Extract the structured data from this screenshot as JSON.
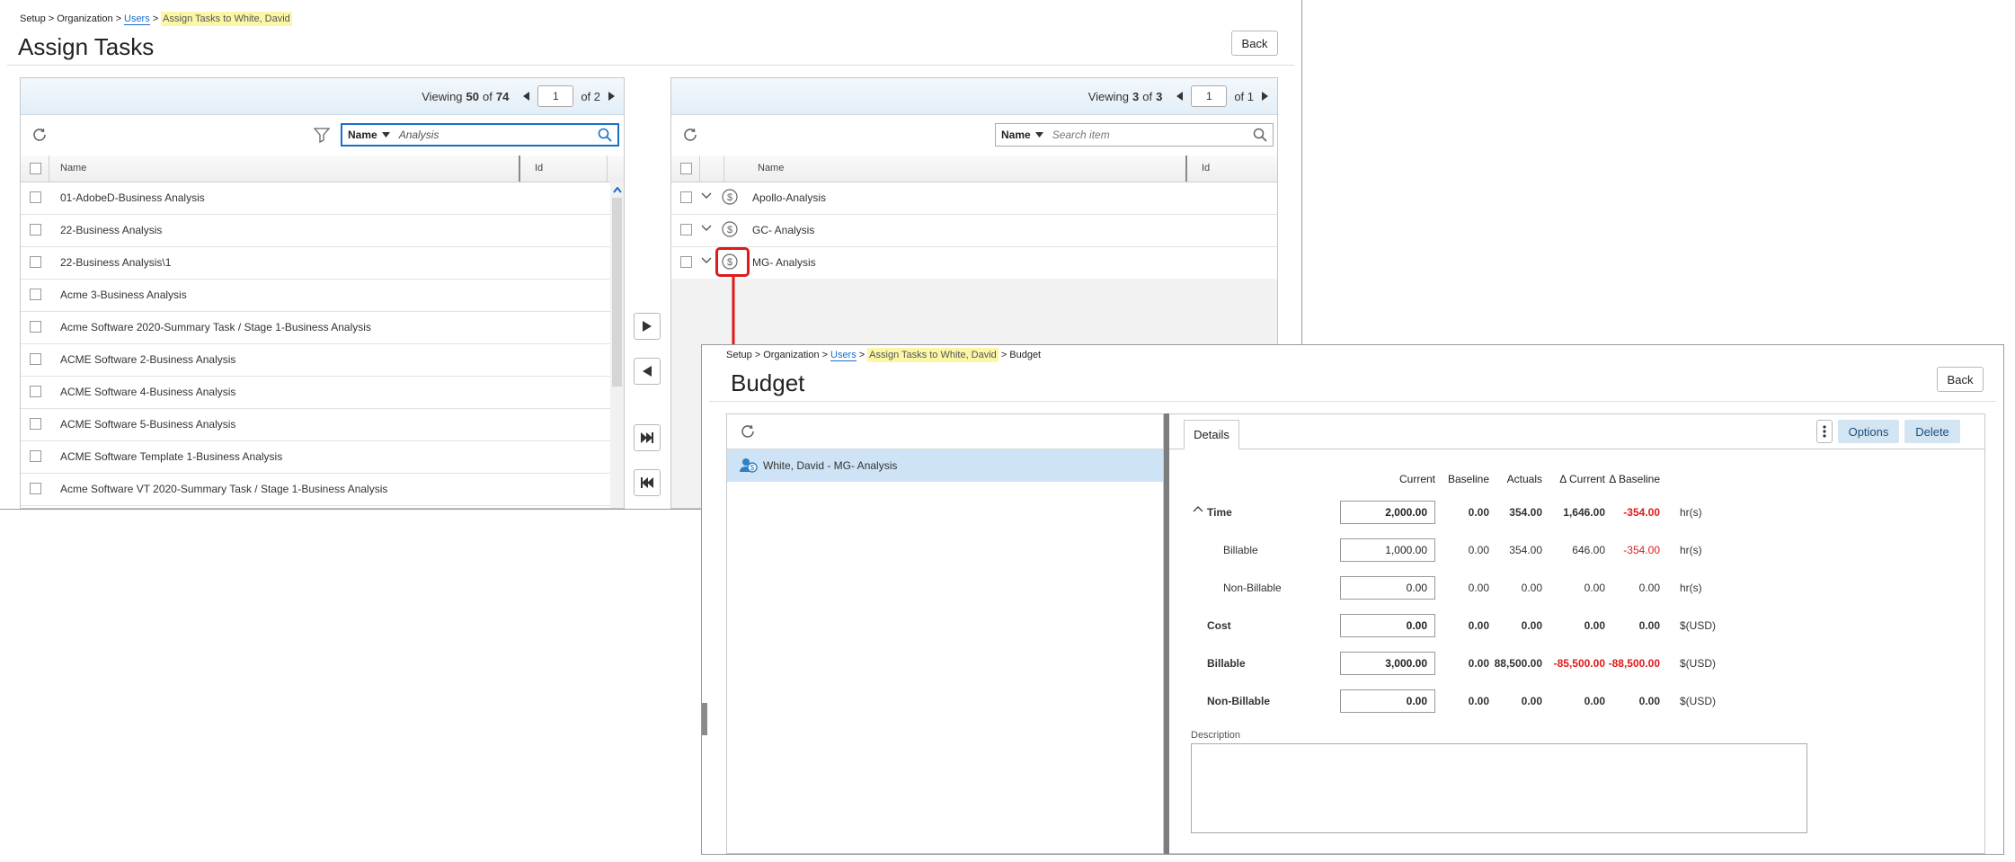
{
  "assign_tasks": {
    "breadcrumb": {
      "setup": "Setup",
      "sep": ">",
      "organization": "Organization",
      "users": "Users",
      "current": "Assign Tasks to White, David"
    },
    "title": "Assign Tasks",
    "back_label": "Back",
    "left_grid": {
      "viewing_prefix": "Viewing",
      "viewing_count": "50",
      "of_label": "of",
      "total": "74",
      "page": "1",
      "page_of": "of 2",
      "search_field": "Name",
      "search_value": "Analysis",
      "columns": [
        "Name",
        "Id"
      ],
      "rows": [
        "01-AdobeD-Business Analysis",
        "22-Business Analysis",
        "22-Business Analysis\\1",
        "Acme 3-Business Analysis",
        "Acme Software 2020-Summary Task / Stage 1-Business Analysis",
        "ACME Software 2-Business Analysis",
        "ACME Software 4-Business Analysis",
        "ACME Software 5-Business Analysis",
        "ACME Software Template 1-Business Analysis",
        "Acme Software VT 2020-Summary Task / Stage 1-Business Analysis"
      ]
    },
    "right_grid": {
      "viewing_prefix": "Viewing",
      "viewing_count": "3",
      "of_label": "of",
      "total": "3",
      "page": "1",
      "page_of": "of 1",
      "search_field": "Name",
      "search_placeholder": "Search item",
      "columns": [
        "Name",
        "Id"
      ],
      "rows": [
        "Apollo-Analysis",
        "GC- Analysis",
        "MG- Analysis"
      ]
    }
  },
  "budget": {
    "breadcrumb": {
      "setup": "Setup",
      "sep": ">",
      "organization": "Organization",
      "users": "Users",
      "assign": "Assign Tasks to White, David",
      "current": "Budget"
    },
    "title": "Budget",
    "back_label": "Back",
    "list_item": "White, David - MG- Analysis",
    "tab_details": "Details",
    "options_label": "Options",
    "delete_label": "Delete",
    "headers": [
      "Current",
      "Baseline",
      "Actuals",
      "Δ Current",
      "Δ Baseline"
    ],
    "rows": [
      {
        "label": "Time",
        "current": "2,000.00",
        "baseline": "0.00",
        "actuals": "354.00",
        "d_current": "1,646.00",
        "d_baseline": "-354.00",
        "unit": "hr(s)",
        "bold": true
      },
      {
        "label": "Billable",
        "current": "1,000.00",
        "baseline": "0.00",
        "actuals": "354.00",
        "d_current": "646.00",
        "d_baseline": "-354.00",
        "unit": "hr(s)",
        "bold": false
      },
      {
        "label": "Non-Billable",
        "current": "0.00",
        "baseline": "0.00",
        "actuals": "0.00",
        "d_current": "0.00",
        "d_baseline": "0.00",
        "unit": "hr(s)",
        "bold": false
      },
      {
        "label": "Cost",
        "current": "0.00",
        "baseline": "0.00",
        "actuals": "0.00",
        "d_current": "0.00",
        "d_baseline": "0.00",
        "unit": "$(USD)",
        "bold": true
      },
      {
        "label": "Billable",
        "current": "3,000.00",
        "baseline": "0.00",
        "actuals": "88,500.00",
        "d_current": "-85,500.00",
        "d_baseline": "-88,500.00",
        "unit": "$(USD)",
        "bold": true
      },
      {
        "label": "Non-Billable",
        "current": "0.00",
        "baseline": "0.00",
        "actuals": "0.00",
        "d_current": "0.00",
        "d_baseline": "0.00",
        "unit": "$(USD)",
        "bold": true
      }
    ],
    "description_label": "Description"
  },
  "colors": {
    "accent": "#1a6fc9",
    "highlight": "#fbf7a6",
    "negative": "#e0191b",
    "callout": "#e0191b",
    "selected_row": "#cfe3f6"
  }
}
